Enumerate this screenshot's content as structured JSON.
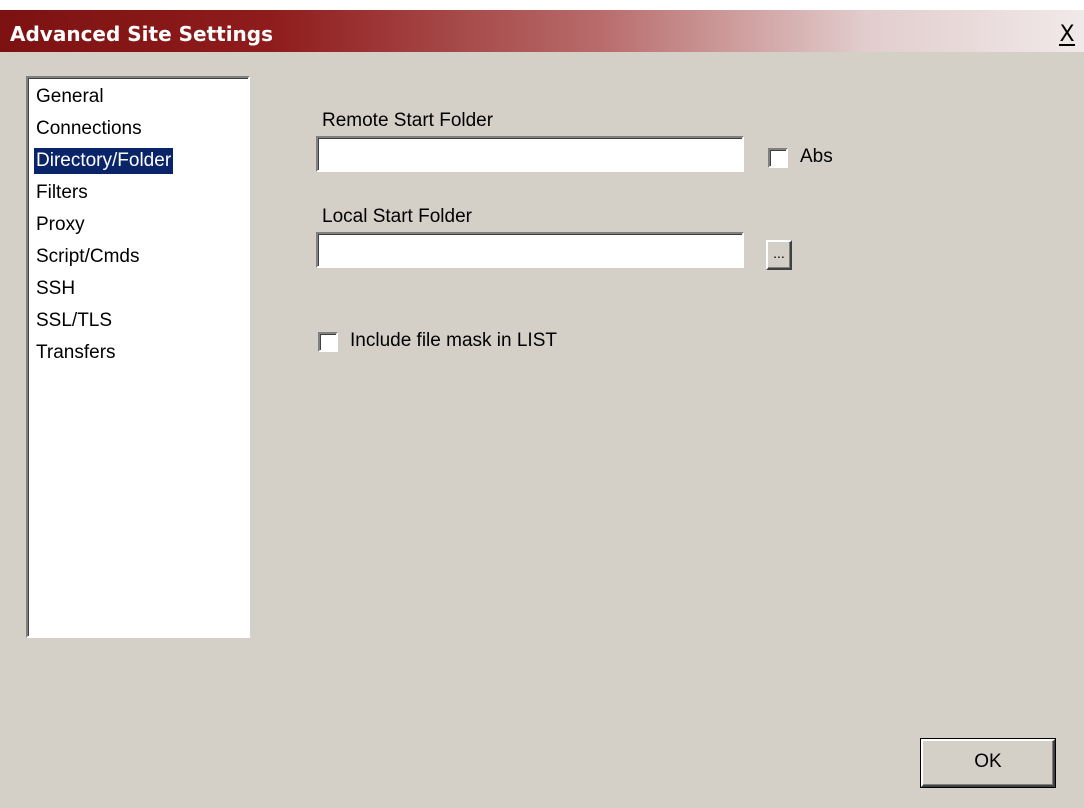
{
  "window": {
    "title": "Advanced Site Settings",
    "close_glyph": "X"
  },
  "nav": {
    "items": [
      {
        "label": "General"
      },
      {
        "label": "Connections"
      },
      {
        "label": "Directory/Folder",
        "selected": true
      },
      {
        "label": "Filters"
      },
      {
        "label": "Proxy"
      },
      {
        "label": "Script/Cmds"
      },
      {
        "label": "SSH"
      },
      {
        "label": "SSL/TLS"
      },
      {
        "label": "Transfers"
      }
    ]
  },
  "form": {
    "remote_start_folder": {
      "label": "Remote Start Folder",
      "value": ""
    },
    "abs_checkbox": {
      "label": "Abs",
      "checked": false
    },
    "local_start_folder": {
      "label": "Local Start Folder",
      "value": ""
    },
    "browse_button": {
      "label": "..."
    },
    "include_mask_checkbox": {
      "label": "Include file mask in LIST",
      "checked": false
    }
  },
  "buttons": {
    "ok_label": "OK"
  },
  "colors": {
    "caption_start": "#7d1212",
    "caption_end": "#f1e9e9",
    "dialog_face": "#d4d0c8",
    "selection": "#0a246a"
  }
}
